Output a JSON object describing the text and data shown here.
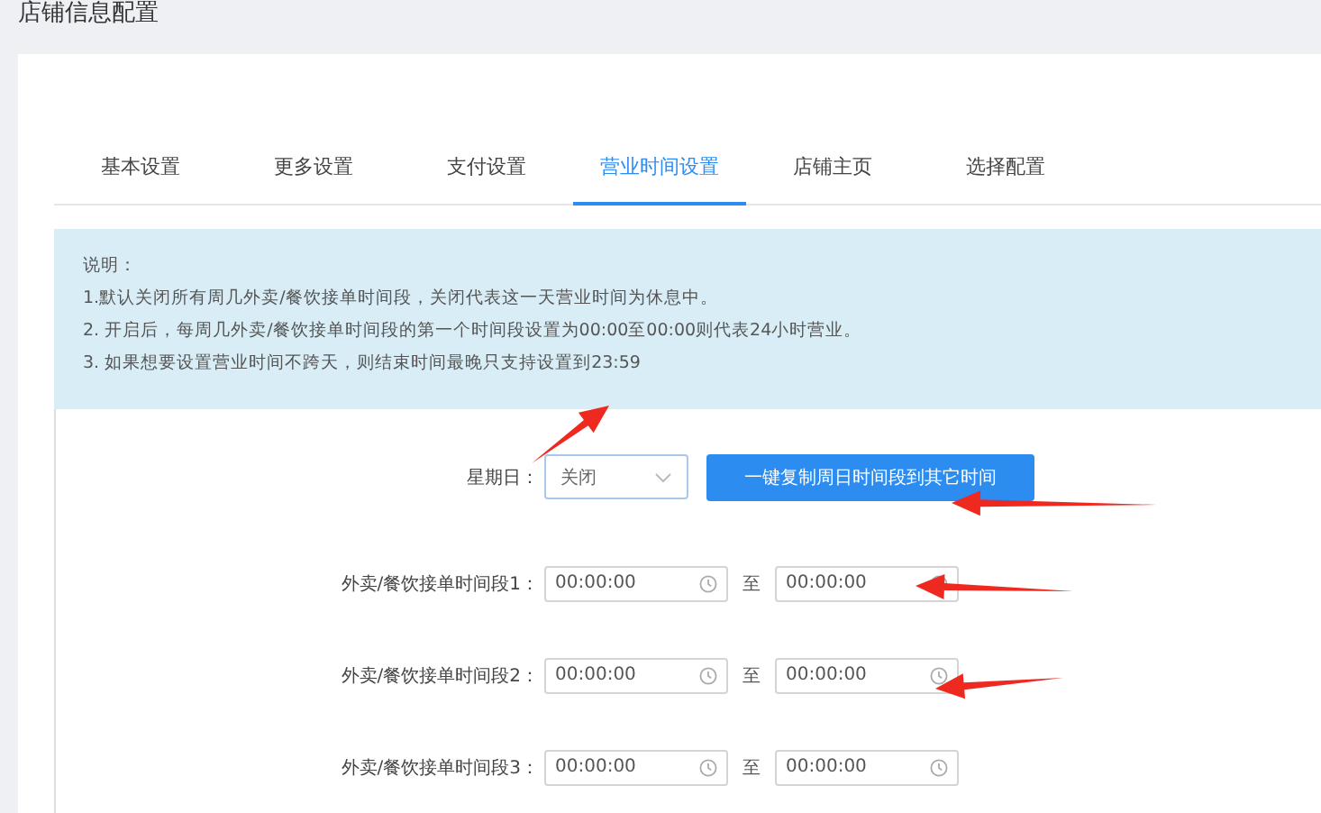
{
  "page_title": "店铺信息配置",
  "tabs": [
    {
      "label": "基本设置",
      "selected": false
    },
    {
      "label": "更多设置",
      "selected": false
    },
    {
      "label": "支付设置",
      "selected": false
    },
    {
      "label": "营业时间设置",
      "selected": true
    },
    {
      "label": "店铺主页",
      "selected": false
    },
    {
      "label": "选择配置",
      "selected": false
    }
  ],
  "notice": {
    "title": "说明：",
    "lines": [
      "1.默认关闭所有周几外卖/餐饮接单时间段，关闭代表这一天营业时间为休息中。",
      "2. 开启后，每周几外卖/餐饮接单时间段的第一个时间段设置为00:00至00:00则代表24小时营业。",
      "3. 如果想要设置营业时间不跨天，则结束时间最晚只支持设置到23:59"
    ]
  },
  "day": {
    "label": "星期日：",
    "value": "关闭"
  },
  "copy_button": "一键复制周日时间段到其它时间",
  "periods": [
    {
      "label": "外卖/餐饮接单时间段1：",
      "start": "00:00:00",
      "separator": "至",
      "end": "00:00:00"
    },
    {
      "label": "外卖/餐饮接单时间段2：",
      "start": "00:00:00",
      "separator": "至",
      "end": "00:00:00"
    },
    {
      "label": "外卖/餐饮接单时间段3：",
      "start": "00:00:00",
      "separator": "至",
      "end": "00:00:00"
    }
  ]
}
